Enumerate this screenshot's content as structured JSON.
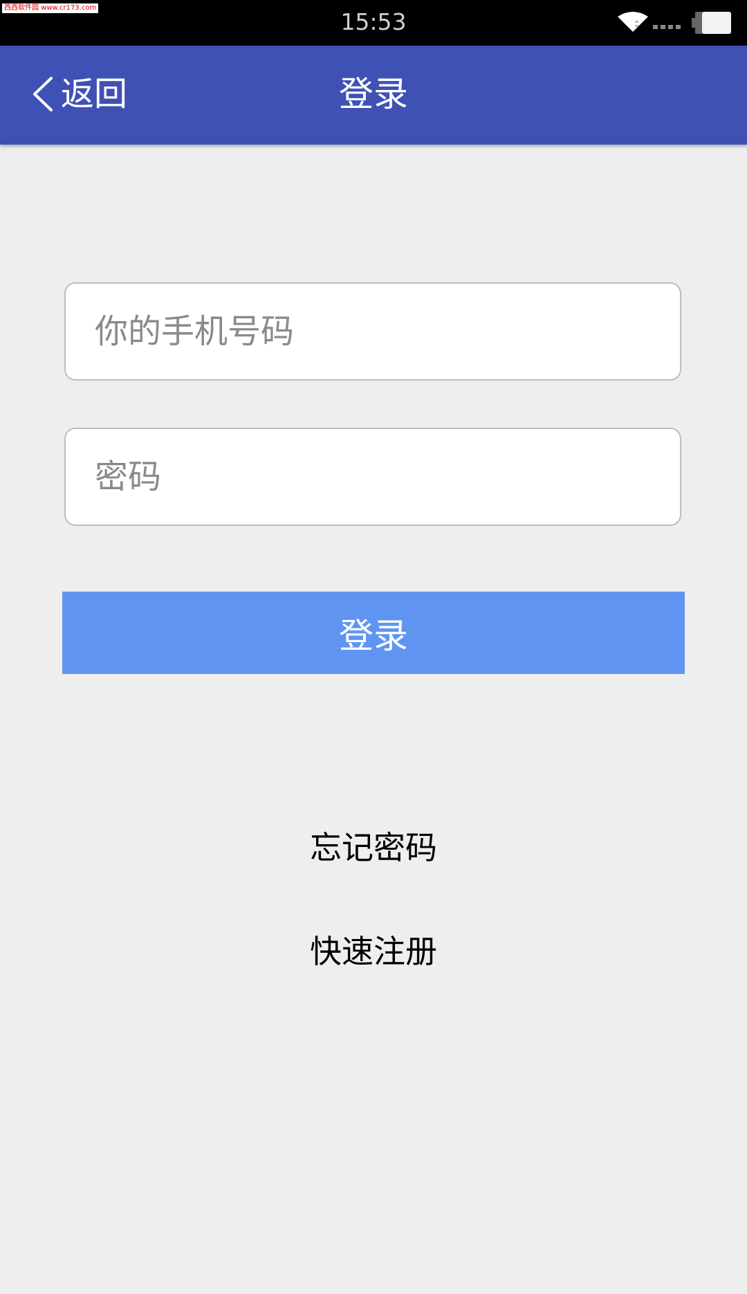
{
  "status_bar": {
    "time": "15:53",
    "watermark": "西西软件园 www.cr173.com"
  },
  "header": {
    "back_label": "返回",
    "title": "登录"
  },
  "form": {
    "phone_placeholder": "你的手机号码",
    "phone_value": "",
    "password_placeholder": "密码",
    "password_value": "",
    "login_label": "登录"
  },
  "links": {
    "forgot_password": "忘记密码",
    "quick_register": "快速注册"
  },
  "colors": {
    "app_bar": "#3f51b5",
    "login_button": "#5f95f1",
    "background": "#eeeeee"
  },
  "icons": [
    "watermark-logo",
    "wifi-icon",
    "signal-icon",
    "battery-icon",
    "chevron-left-icon"
  ]
}
